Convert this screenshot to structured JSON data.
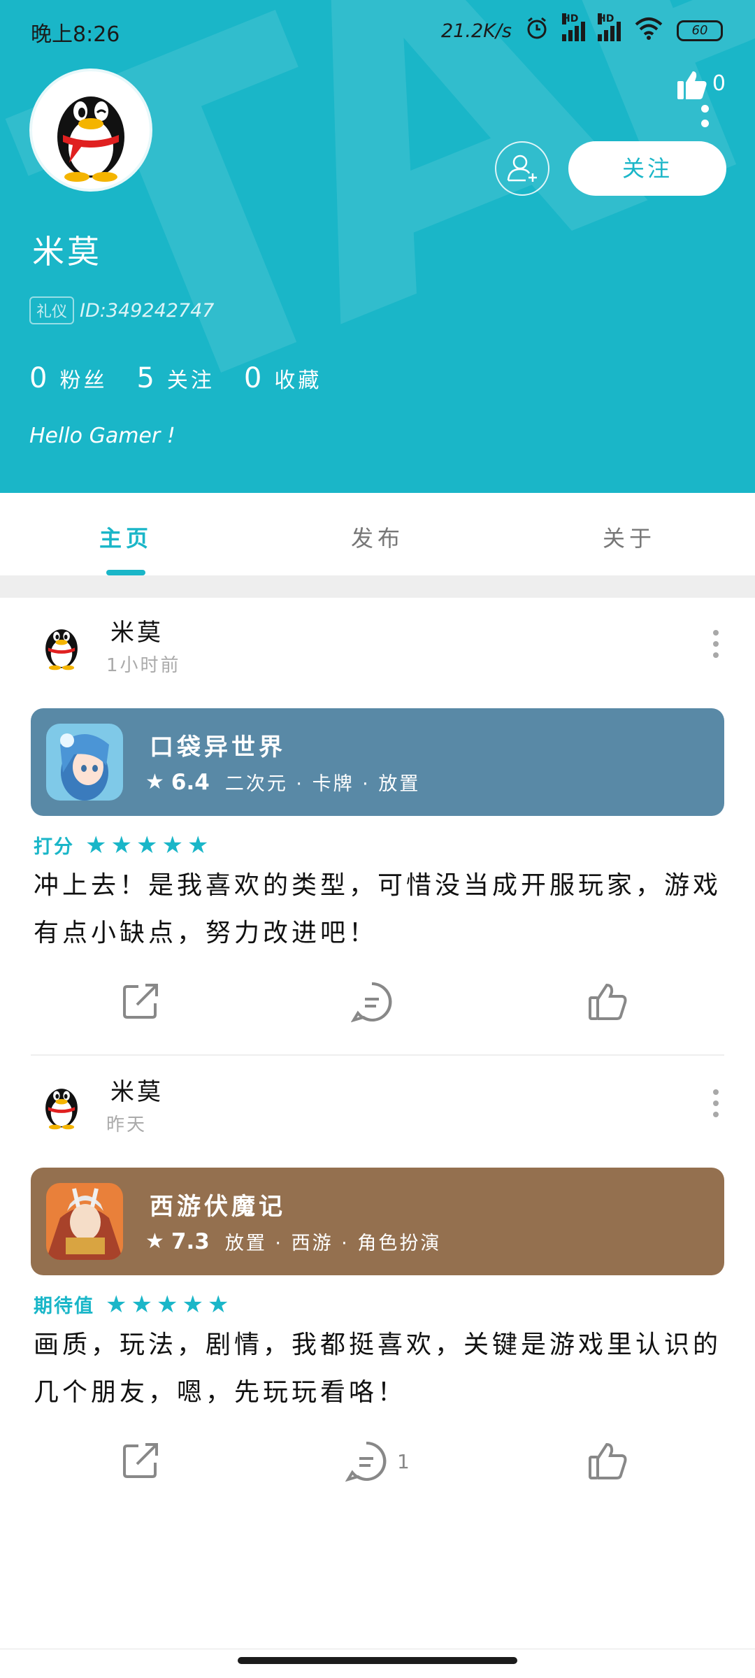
{
  "status_bar": {
    "time": "晚上8:26",
    "net_speed": "21.2K/s",
    "signal_label": "HD",
    "battery": "60"
  },
  "profile": {
    "name": "米莫",
    "badge": "礼仪",
    "uid": "ID:349242747",
    "likes": "0",
    "follow_label": "关注",
    "stats": {
      "fans": {
        "value": "0",
        "label": "粉丝"
      },
      "following": {
        "value": "5",
        "label": "关注"
      },
      "favorites": {
        "value": "0",
        "label": "收藏"
      }
    },
    "bio": "Hello Gamer !"
  },
  "tabs": [
    {
      "label": "主页",
      "active": true
    },
    {
      "label": "发布",
      "active": false
    },
    {
      "label": "关于",
      "active": false
    }
  ],
  "posts": [
    {
      "user": "米莫",
      "time": "1小时前",
      "game": {
        "name": "口袋异世界",
        "score": "6.4",
        "tags": "二次元 · 卡牌 · 放置",
        "card_color": "#5989a6"
      },
      "rating_label": "打分",
      "stars": 5,
      "text": "冲上去！是我喜欢的类型，可惜没当成开服玩家，游戏有点小缺点，努力改进吧！",
      "comment_count": ""
    },
    {
      "user": "米莫",
      "time": "昨天",
      "game": {
        "name": "西游伏魔记",
        "score": "7.3",
        "tags": "放置 · 西游 · 角色扮演",
        "card_color": "#94704f"
      },
      "rating_label": "期待值",
      "stars": 5,
      "text": "画质，玩法，剧情，我都挺喜欢，关键是游戏里认识的几个朋友，嗯，先玩玩看咯！",
      "comment_count": "1"
    }
  ],
  "colors": {
    "accent": "#1ab6c8",
    "tab_gap": "#eeeeee"
  },
  "icons": {
    "share": "share-icon",
    "comment": "comment-icon",
    "like": "thumbs-up-icon",
    "add_friend": "add-friend-icon",
    "more": "more-vertical-icon",
    "star": "star-icon"
  }
}
